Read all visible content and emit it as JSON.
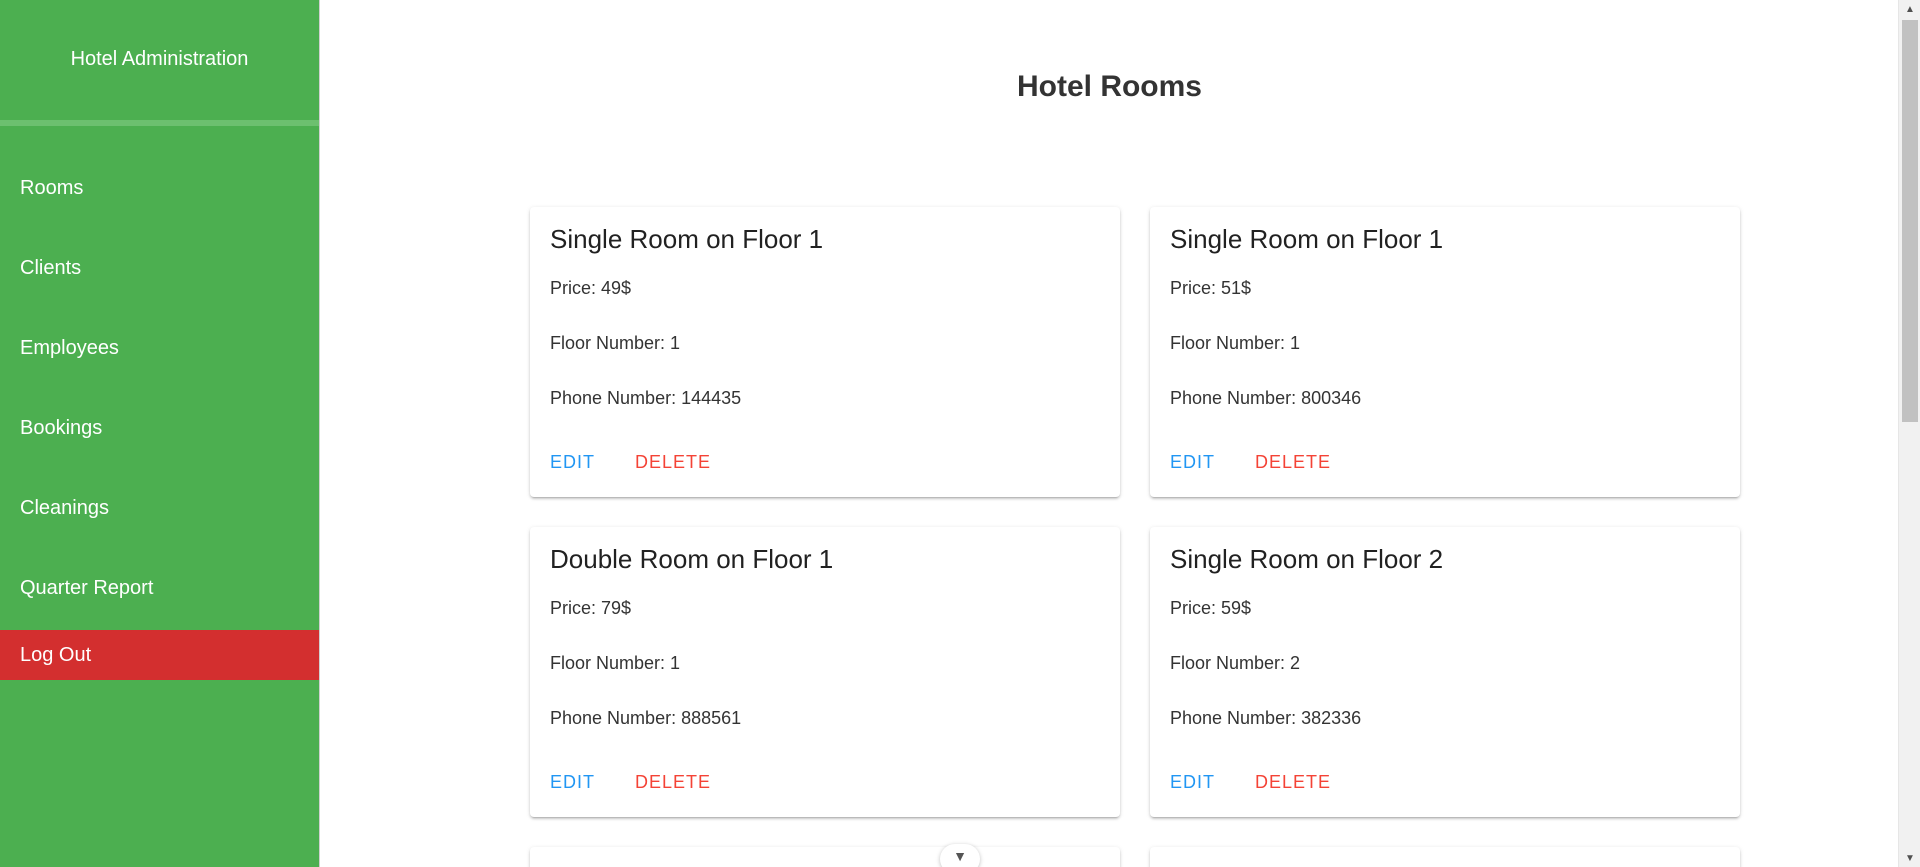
{
  "sidebar": {
    "brand": "Hotel Administration",
    "items": [
      {
        "label": "Rooms"
      },
      {
        "label": "Clients"
      },
      {
        "label": "Employees"
      },
      {
        "label": "Bookings"
      },
      {
        "label": "Cleanings"
      },
      {
        "label": "Quarter Report"
      }
    ],
    "logout": "Log Out"
  },
  "main": {
    "title": "Hotel Rooms",
    "rooms": [
      {
        "title": "Single Room on Floor 1",
        "price": "Price: 49$",
        "floor": "Floor Number: 1",
        "phone": "Phone Number: 144435",
        "edit": "EDIT",
        "delete": "DELETE"
      },
      {
        "title": "Single Room on Floor 1",
        "price": "Price: 51$",
        "floor": "Floor Number: 1",
        "phone": "Phone Number: 800346",
        "edit": "EDIT",
        "delete": "DELETE"
      },
      {
        "title": "Double Room on Floor 1",
        "price": "Price: 79$",
        "floor": "Floor Number: 1",
        "phone": "Phone Number: 888561",
        "edit": "EDIT",
        "delete": "DELETE"
      },
      {
        "title": "Single Room on Floor 2",
        "price": "Price: 59$",
        "floor": "Floor Number: 2",
        "phone": "Phone Number: 382336",
        "edit": "EDIT",
        "delete": "DELETE"
      }
    ],
    "scroll_down_icon": "chevron-down-icon"
  },
  "colors": {
    "sidebar_bg": "#4caf50",
    "logout_bg": "#d32f2f",
    "edit": "#2196f3",
    "delete": "#f44336"
  }
}
